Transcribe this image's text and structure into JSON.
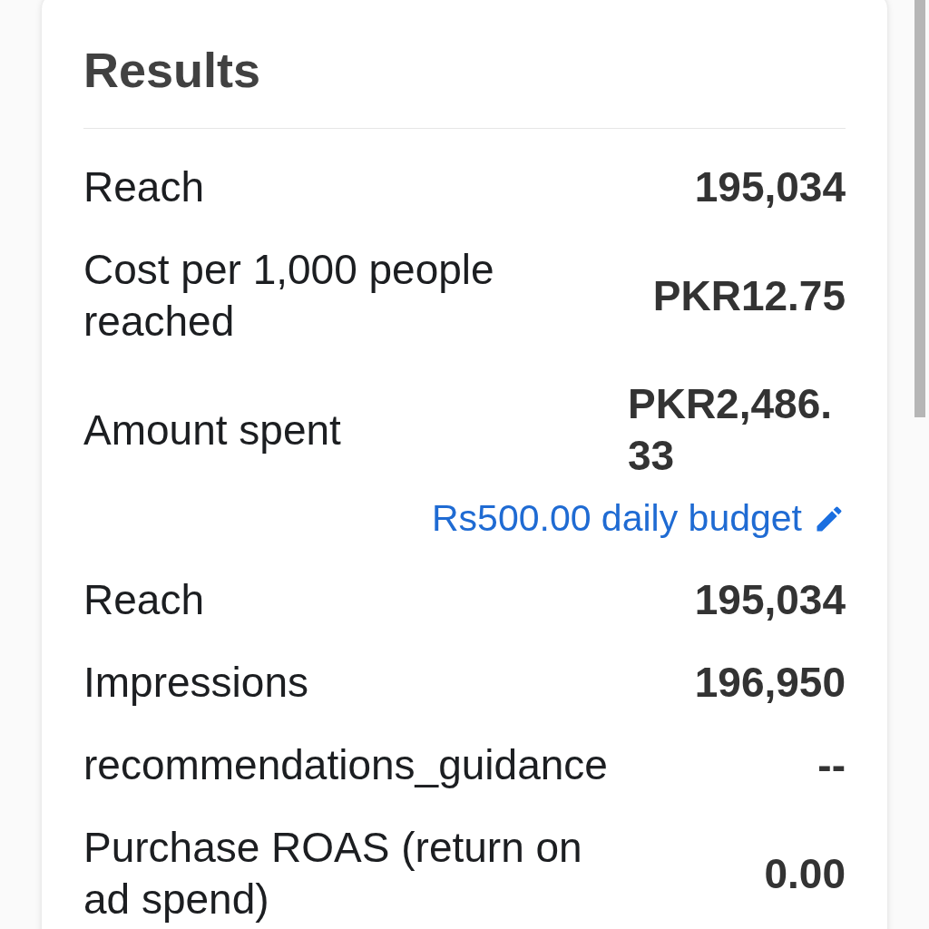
{
  "title": "Results",
  "rows": [
    {
      "label": "Reach",
      "value": "195,034"
    },
    {
      "label": "Cost per 1,000 people reached",
      "value": "PKR12.75"
    },
    {
      "label": "Amount spent",
      "value": "PKR2,486.33",
      "budget_link": {
        "text": "Rs500.00 daily budget"
      }
    },
    {
      "label": "Reach",
      "value": "195,034"
    },
    {
      "label": "Impressions",
      "value": "196,950"
    },
    {
      "label": "recommendations_guidance",
      "value": "--"
    },
    {
      "label": "Purchase ROAS (return on ad spend)",
      "value": "0.00"
    }
  ]
}
